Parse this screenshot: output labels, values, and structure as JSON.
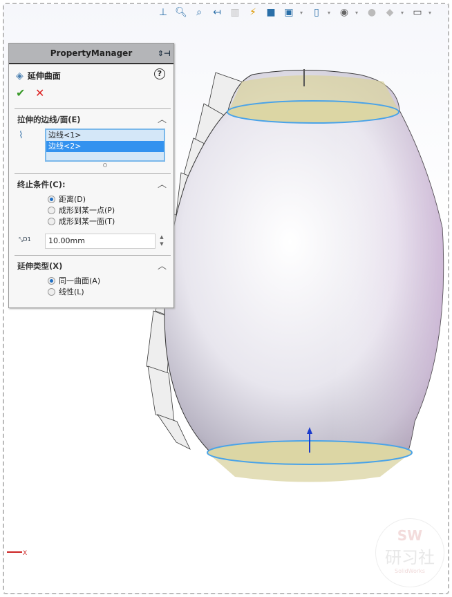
{
  "toolbar": {
    "icons": [
      "view-normal-icon",
      "zoom-to-fit-icon",
      "zoom-to-area-icon",
      "previous-view-icon",
      "section-view-icon",
      "dynamic-annotation-icon",
      "view-orientation-icon",
      "display-style-icon",
      "hide-show-items-icon",
      "edit-appearance-icon",
      "apply-scene-icon",
      "view-settings-icon"
    ]
  },
  "property_manager": {
    "title": "PropertyManager",
    "feature_name": "延伸曲面",
    "help": "?",
    "ok": "✔",
    "cancel": "✕",
    "edges_section": {
      "title": "拉伸的边线/面(E)",
      "items": [
        "边线<1>",
        "边线<2>"
      ],
      "selected_index": 1
    },
    "end_condition": {
      "title": "终止条件(C):",
      "options": [
        "距离(D)",
        "成形到某一点(P)",
        "成形到某一面(T)"
      ],
      "selected_index": 0,
      "distance_value": "10.00mm",
      "distance_icon_label": "D1"
    },
    "extension_type": {
      "title": "延伸类型(X)",
      "options": [
        "同一曲面(A)",
        "线性(L)"
      ],
      "selected_index": 0
    }
  },
  "axis": {
    "x_label": "X"
  },
  "watermark": {
    "line1": "SW",
    "line2": "研习社",
    "line3": "SolidWorks"
  },
  "colors": {
    "accent": "#3392ef",
    "edge": "#4aa3e8",
    "face": "#d9d3a0"
  }
}
